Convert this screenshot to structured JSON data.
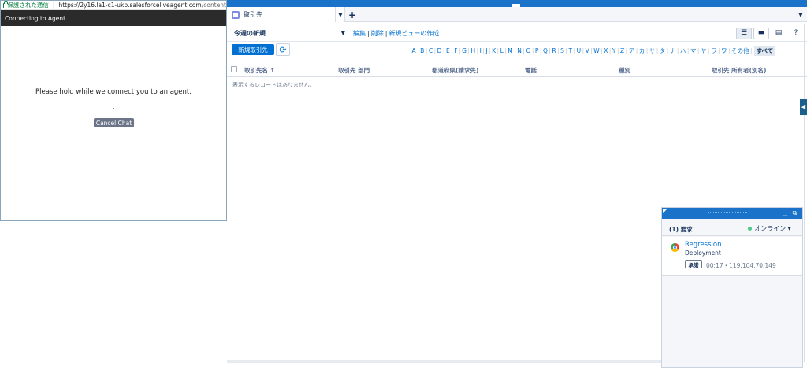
{
  "browser": {
    "secure_label": "保護された通信",
    "url_host": "https://2y16.la1-c1-ukb.salesforceliveagent.com",
    "url_path": "/content"
  },
  "chat_window": {
    "title": "Connecting to Agent...",
    "message": "Please hold while we connect you to an agent.",
    "cancel_label": "Cancel Chat"
  },
  "console": {
    "tab": {
      "label": "取引先",
      "icon": "account-icon"
    },
    "view": {
      "selected": "今週の新規",
      "links": [
        "編集",
        "削除",
        "新規ビューの作成"
      ],
      "help": "?"
    },
    "actions": {
      "new_label": "新規取引先",
      "refresh_icon": "refresh-icon"
    },
    "alphabet": [
      "A",
      "B",
      "C",
      "D",
      "E",
      "F",
      "G",
      "H",
      "I",
      "J",
      "K",
      "L",
      "M",
      "N",
      "O",
      "P",
      "Q",
      "R",
      "S",
      "T",
      "U",
      "V",
      "W",
      "X",
      "Y",
      "Z",
      "ア",
      "カ",
      "サ",
      "タ",
      "ナ",
      "ハ",
      "マ",
      "ヤ",
      "ラ",
      "ワ",
      "その他"
    ],
    "alphabet_selected": "すべて",
    "table": {
      "columns": [
        "取引先名 ↑",
        "取引先 部門",
        "都道府県(請求先)",
        "電話",
        "種別",
        "取引先 所有者(別名)"
      ],
      "empty_message": "表示するレコードはありません。"
    }
  },
  "omni": {
    "request_count": "(1) 要求",
    "status": "オンライン",
    "status_color": "#4bca81",
    "item": {
      "name": "Regression",
      "subtitle": "Deployment",
      "badge": "承諾",
      "meta": "00:17・119.104.70.149"
    }
  },
  "colors": {
    "brand_blue": "#1a73c9",
    "link_blue": "#0070d2",
    "popup_title_bg": "#2b2b2b",
    "cancel_bg": "#6b7488"
  }
}
